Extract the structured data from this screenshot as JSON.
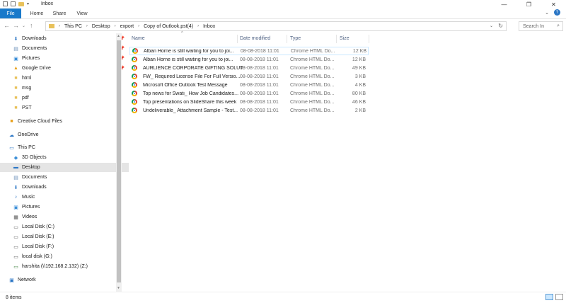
{
  "window": {
    "title": "Inbox"
  },
  "ribbon": {
    "tabs": [
      "File",
      "Home",
      "Share",
      "View"
    ]
  },
  "address": {
    "crumbs": [
      "This PC",
      "Desktop",
      "export",
      "Copy of Outlook.pst(4)",
      "Inbox"
    ],
    "search_placeholder": "Search In"
  },
  "nav": {
    "quick": [
      {
        "label": "Downloads",
        "icon": "download-arrow-icon",
        "pinned": true
      },
      {
        "label": "Documents",
        "icon": "document-icon",
        "pinned": true
      },
      {
        "label": "Pictures",
        "icon": "pictures-icon",
        "pinned": true
      },
      {
        "label": "Google Drive",
        "icon": "google-drive-icon",
        "pinned": true
      },
      {
        "label": "html",
        "icon": "folder-icon"
      },
      {
        "label": "msg",
        "icon": "folder-icon"
      },
      {
        "label": "pdf",
        "icon": "folder-icon"
      },
      {
        "label": "PST",
        "icon": "folder-icon"
      }
    ],
    "creative": "Creative Cloud Files",
    "onedrive": "OneDrive",
    "thispc": "This PC",
    "pc": [
      {
        "label": "3D Objects",
        "icon": "3d-objects-icon"
      },
      {
        "label": "Desktop",
        "icon": "desktop-icon",
        "selected": true
      },
      {
        "label": "Documents",
        "icon": "document-icon"
      },
      {
        "label": "Downloads",
        "icon": "download-arrow-icon"
      },
      {
        "label": "Music",
        "icon": "music-icon"
      },
      {
        "label": "Pictures",
        "icon": "pictures-icon"
      },
      {
        "label": "Videos",
        "icon": "videos-icon"
      },
      {
        "label": "Local Disk (C:)",
        "icon": "drive-icon"
      },
      {
        "label": "Local Disk (E:)",
        "icon": "drive-icon"
      },
      {
        "label": "Local Disk (F:)",
        "icon": "drive-icon"
      },
      {
        "label": "local disk (G:)",
        "icon": "drive-icon"
      },
      {
        "label": "harshita (\\\\192.168.2.132) (Z:)",
        "icon": "network-drive-icon"
      }
    ],
    "network": "Network"
  },
  "columns": {
    "name": "Name",
    "date": "Date modified",
    "type": "Type",
    "size": "Size"
  },
  "files": [
    {
      "name": "Alban Horne is still waiting for you to joi...",
      "date": "08-08-2018 11:01",
      "type": "Chrome HTML Do...",
      "size": "12 KB",
      "selected": true
    },
    {
      "name": "Alban Horne is still waiting for you to joi...",
      "date": "08-08-2018 11:01",
      "type": "Chrome HTML Do...",
      "size": "12 KB"
    },
    {
      "name": "AURLIENCE CORPORATE GIFTING SOLUT...",
      "date": "08-08-2018 11:01",
      "type": "Chrome HTML Do...",
      "size": "49 KB"
    },
    {
      "name": "FW_ Required License File For Full Versio...",
      "date": "08-08-2018 11:01",
      "type": "Chrome HTML Do...",
      "size": "3 KB"
    },
    {
      "name": "Microsoft Office Outlook Test Message",
      "date": "08-08-2018 11:01",
      "type": "Chrome HTML Do...",
      "size": "4 KB"
    },
    {
      "name": "Top news for Swati_ How Job Candidates...",
      "date": "08-08-2018 11:01",
      "type": "Chrome HTML Do...",
      "size": "80 KB"
    },
    {
      "name": "Top presentations on SlideShare this week",
      "date": "08-08-2018 11:01",
      "type": "Chrome HTML Do...",
      "size": "46 KB"
    },
    {
      "name": "Undeliverable_ Attachment Sample - Test...",
      "date": "08-08-2018 11:01",
      "type": "Chrome HTML Do...",
      "size": "2 KB"
    }
  ],
  "status": {
    "count": "8 items"
  },
  "colors": {
    "accent": "#1979ca",
    "selection": "#e5e5e5",
    "header_text": "#4d6082"
  }
}
